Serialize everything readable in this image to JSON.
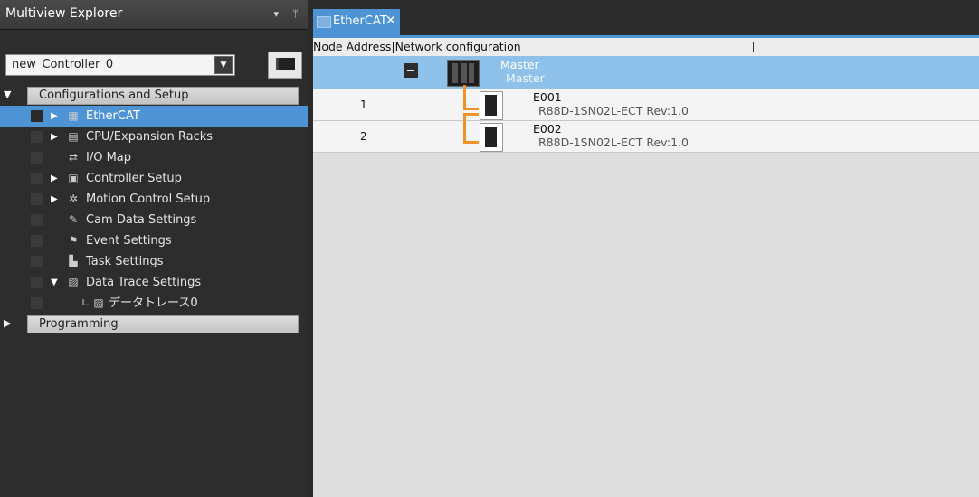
{
  "explorer": {
    "title": "Multiview Explorer",
    "dropdown_glyph": "▾",
    "pin_glyph": " ѱ",
    "controller_select": "new_Controller_0"
  },
  "tree": {
    "config_group": "Configurations and Setup",
    "items": [
      {
        "label": "EtherCAT",
        "icon": "ethercat-icon",
        "expandable": true,
        "selected": true
      },
      {
        "label": "CPU/Expansion Racks",
        "icon": "rack-icon",
        "expandable": true
      },
      {
        "label": "I/O Map",
        "icon": "io-map-icon",
        "expandable": false
      },
      {
        "label": "Controller Setup",
        "icon": "controller-setup-icon",
        "expandable": true
      },
      {
        "label": "Motion Control Setup",
        "icon": "gear-icon",
        "expandable": true
      },
      {
        "label": "Cam Data Settings",
        "icon": "cam-icon",
        "expandable": false
      },
      {
        "label": "Event Settings",
        "icon": "flag-icon",
        "expandable": false
      },
      {
        "label": "Task Settings",
        "icon": "task-icon",
        "expandable": false
      },
      {
        "label": "Data Trace Settings",
        "icon": "trace-icon",
        "expandable": true,
        "expanded": true
      },
      {
        "label": "データトレース0",
        "icon": "trace-icon",
        "child": true
      }
    ],
    "programming_group": "Programming"
  },
  "tab": {
    "label": "EtherCAT",
    "close": "✕"
  },
  "network": {
    "header": "Node Address|Network configuration",
    "master": {
      "name": "Master",
      "sub": "Master"
    },
    "nodes": [
      {
        "address": "1",
        "name": "E001",
        "model": "R88D-1SN02L-ECT Rev:1.0"
      },
      {
        "address": "2",
        "name": "E002",
        "model": "R88D-1SN02L-ECT Rev:1.0"
      }
    ]
  },
  "colors": {
    "accent": "#4e94d4",
    "master_row": "#8ec2ea",
    "wire": "#f0922a"
  }
}
